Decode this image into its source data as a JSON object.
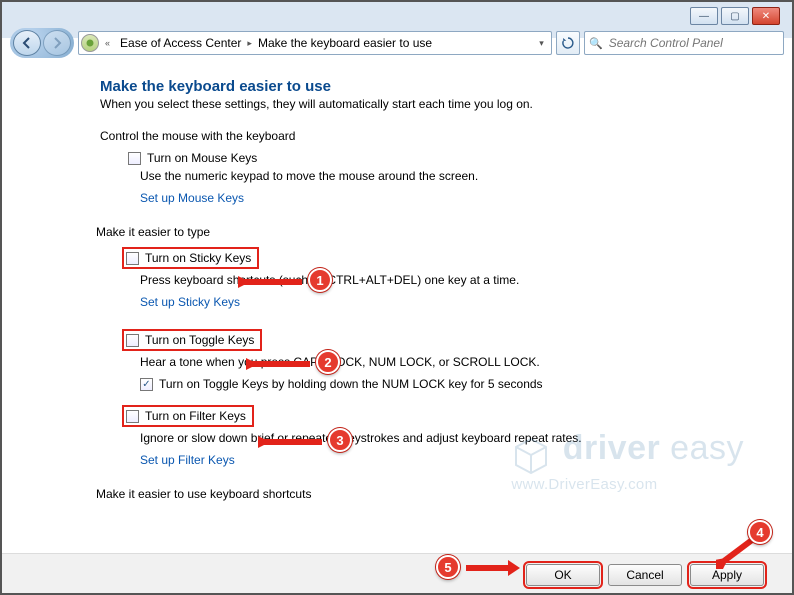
{
  "window_controls": {
    "min": "—",
    "max": "▢",
    "close": "✕"
  },
  "breadcrumb": {
    "icon_label": "control-panel-icon",
    "seg1": "Ease of Access Center",
    "seg2": "Make the keyboard easier to use"
  },
  "search": {
    "placeholder": "Search Control Panel"
  },
  "page": {
    "title": "Make the keyboard easier to use",
    "subtitle": "When you select these settings, they will automatically start each time you log on."
  },
  "sec1": {
    "head": "Control the mouse with the keyboard",
    "opt1": "Turn on Mouse Keys",
    "desc": "Use the numeric keypad to move the mouse around the screen.",
    "link": "Set up Mouse Keys"
  },
  "sec2": {
    "head": "Make it easier to type",
    "sticky": {
      "label": "Turn on Sticky Keys",
      "desc": "Press keyboard shortcuts (such as CTRL+ALT+DEL) one key at a time.",
      "link": "Set up Sticky Keys"
    },
    "toggle": {
      "label": "Turn on Toggle Keys",
      "desc": "Hear a tone when you press CAPS LOCK, NUM LOCK, or SCROLL LOCK.",
      "sub": "Turn on Toggle Keys by holding down the NUM LOCK key for 5 seconds"
    },
    "filter": {
      "label": "Turn on Filter Keys",
      "desc": "Ignore or slow down brief or repeated keystrokes and adjust keyboard repeat rates.",
      "link": "Set up Filter Keys"
    }
  },
  "sec3": {
    "head": "Make it easier to use keyboard shortcuts"
  },
  "buttons": {
    "ok": "OK",
    "cancel": "Cancel",
    "apply": "Apply"
  },
  "annotations": {
    "b1": "1",
    "b2": "2",
    "b3": "3",
    "b4": "4",
    "b5": "5"
  },
  "watermark": {
    "line1a": "driver",
    "line1b": " easy",
    "line2": "www.DriverEasy.com"
  }
}
